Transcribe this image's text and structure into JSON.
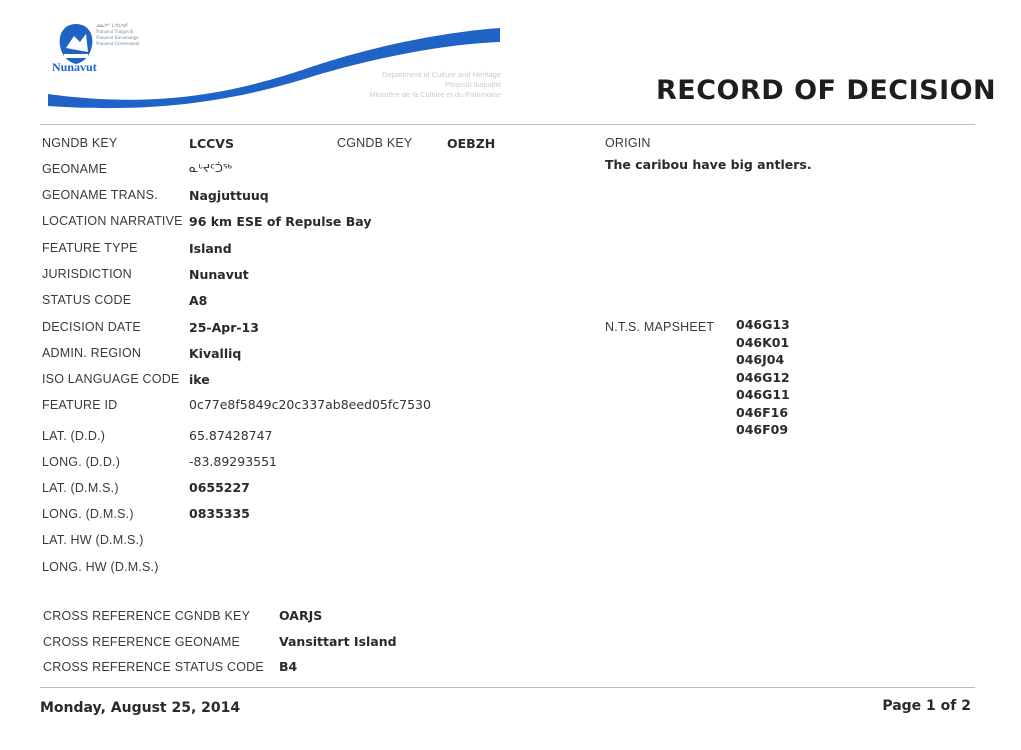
{
  "header": {
    "title": "RECORD OF DECISION",
    "logo_label": "Nunavut",
    "department_lines": [
      "Department of Culture and Heritage",
      "Pitqosiit Ikajuqtiit",
      "Ministère de la Culture et du Patrimoine"
    ],
    "brand_color": "#1f63c6"
  },
  "fields_left": [
    {
      "label": "NGNDB KEY",
      "value": "LCCVS"
    },
    {
      "label": "GEONAME",
      "value": "ᓇᒡᔪᑦᑑᖅ"
    },
    {
      "label": "GEONAME TRANS.",
      "value": "Nagjuttuuq"
    },
    {
      "label": "LOCATION NARRATIVE",
      "value": "96 km ESE of Repulse Bay"
    },
    {
      "label": "FEATURE TYPE",
      "value": "Island"
    },
    {
      "label": "JURISDICTION",
      "value": "Nunavut"
    },
    {
      "label": "STATUS CODE",
      "value": "A8"
    },
    {
      "label": "DECISION DATE",
      "value": "25-Apr-13"
    },
    {
      "label": "ADMIN. REGION",
      "value": "Kivalliq"
    },
    {
      "label": "ISO LANGUAGE CODE",
      "value": "ike"
    },
    {
      "label": "FEATURE ID",
      "value": "0c77e8f5849c20c337ab8eed05fc7530"
    },
    {
      "label": "LAT. (D.D.)",
      "value": "65.87428747"
    },
    {
      "label": "LONG. (D.D.)",
      "value": "-83.89293551"
    },
    {
      "label": "LAT. (D.M.S.)",
      "value": "0655227"
    },
    {
      "label": "LONG. (D.M.S.)",
      "value": "0835335"
    },
    {
      "label": "LAT. HW (D.M.S.)",
      "value": ""
    },
    {
      "label": "LONG. HW (D.M.S.)",
      "value": ""
    }
  ],
  "cgndb": {
    "label": "CGNDB KEY",
    "value": "OEBZH"
  },
  "origin": {
    "label": "ORIGIN",
    "value": "The caribou have big antlers."
  },
  "nts": {
    "label": "N.T.S. MAPSHEET",
    "values": [
      "046G13",
      "046K01",
      "046J04",
      "046G12",
      "046G11",
      "046F16",
      "046F09"
    ]
  },
  "cross_reference": [
    {
      "label": "CROSS REFERENCE CGNDB KEY",
      "value": "OARJS"
    },
    {
      "label": "CROSS REFERENCE GEONAME",
      "value": "Vansittart Island"
    },
    {
      "label": "CROSS REFERENCE STATUS CODE",
      "value": "B4"
    }
  ],
  "footer": {
    "date": "Monday, August 25, 2014",
    "page": "Page 1 of 2"
  }
}
